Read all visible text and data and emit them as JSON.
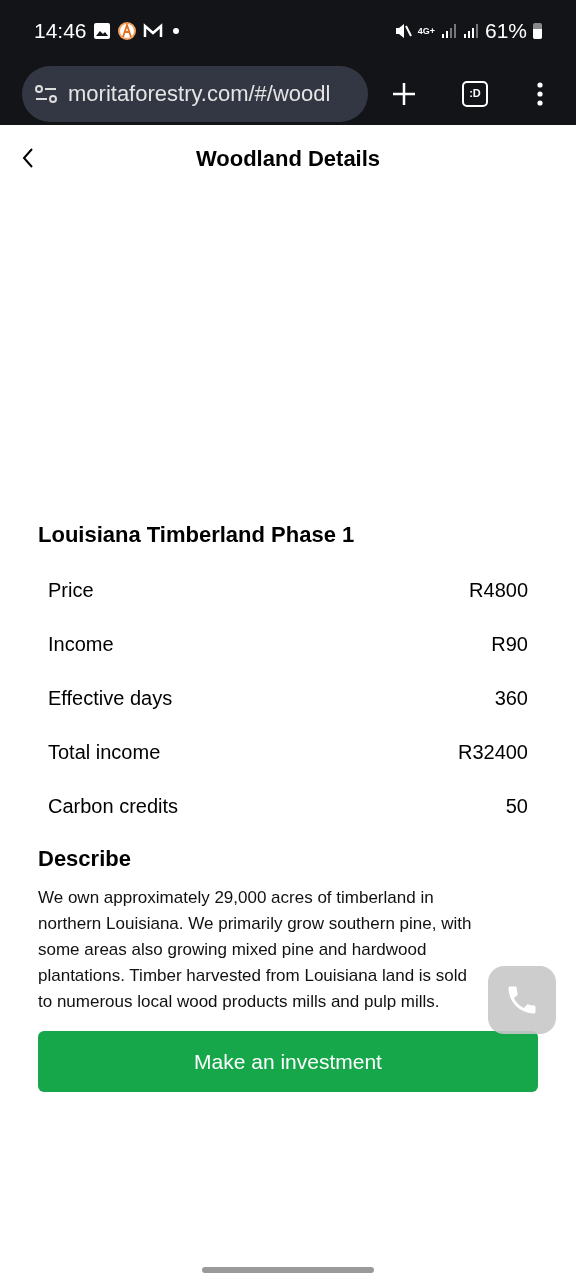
{
  "status_bar": {
    "time": "14:46",
    "network": "4G+",
    "battery": "61%"
  },
  "browser": {
    "url": "moritaforestry.com/#/woodl",
    "tab_button": ":D"
  },
  "header": {
    "title": "Woodland Details"
  },
  "product": {
    "name": "Louisiana Timberland Phase 1",
    "details": [
      {
        "label": "Price",
        "value": "R4800"
      },
      {
        "label": "Income",
        "value": "R90"
      },
      {
        "label": "Effective days",
        "value": "360"
      },
      {
        "label": "Total income",
        "value": "R32400"
      },
      {
        "label": "Carbon credits",
        "value": "50"
      }
    ],
    "describe_heading": "Describe",
    "description": "We own approximately 29,000 acres of timberland in northern Louisiana. We primarily grow southern pine, with some areas also growing mixed pine and hardwood plantations. Timber harvested from Louisiana land is sold to numerous local wood products mills and pulp mills."
  },
  "invest_button": "Make an investment"
}
